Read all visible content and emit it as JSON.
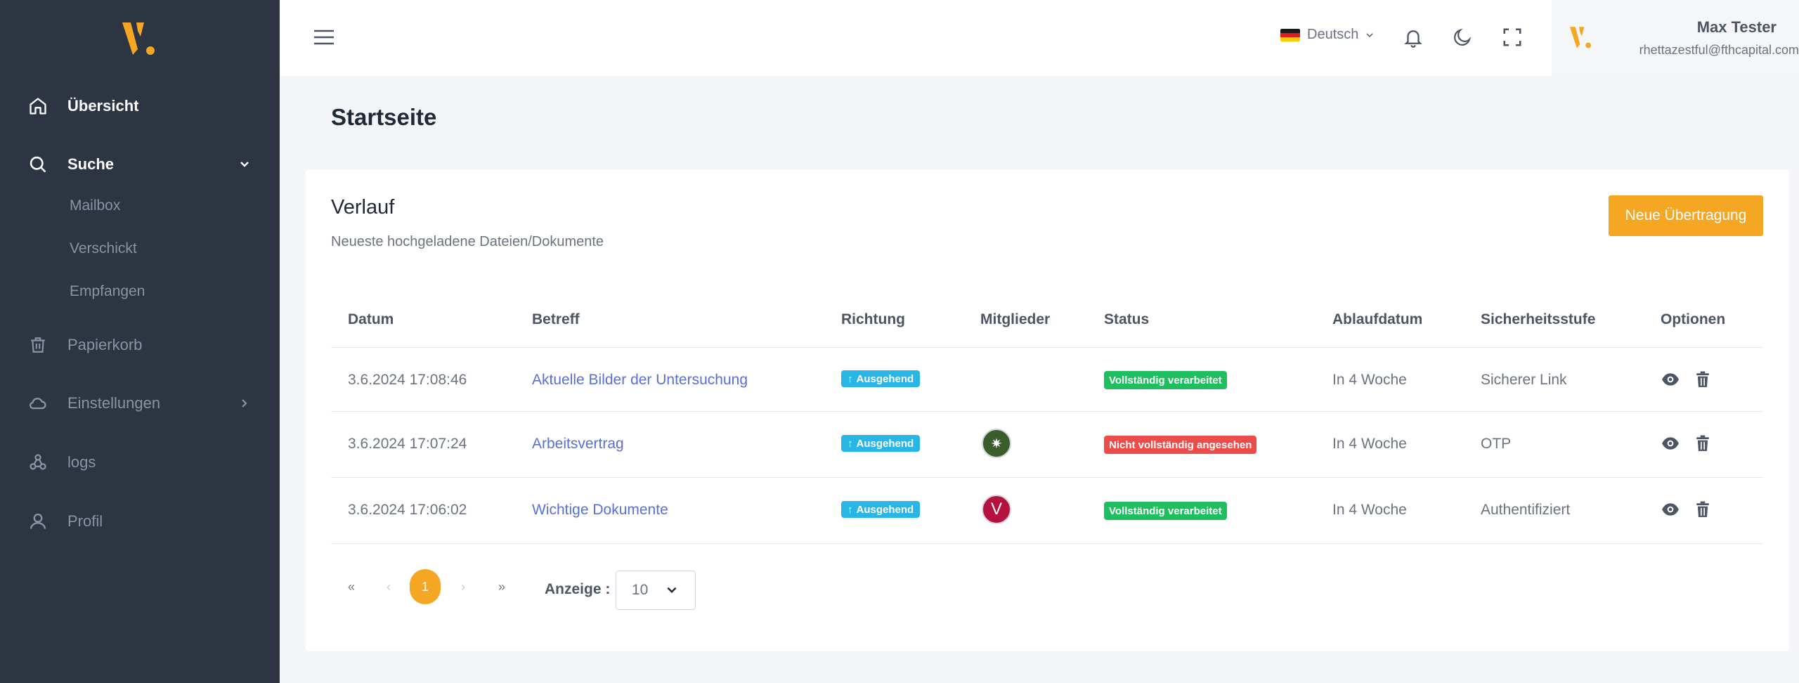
{
  "sidebar": {
    "items": [
      {
        "label": "Übersicht",
        "icon": "home-icon"
      },
      {
        "label": "Suche",
        "icon": "search-icon"
      },
      {
        "label": "Papierkorb",
        "icon": "trash-icon"
      },
      {
        "label": "Einstellungen",
        "icon": "cloud-icon"
      },
      {
        "label": "logs",
        "icon": "webhook-icon"
      },
      {
        "label": "Profil",
        "icon": "user-icon"
      }
    ],
    "search_sub": [
      "Mailbox",
      "Verschickt",
      "Empfangen"
    ]
  },
  "topbar": {
    "language": "Deutsch",
    "user_name": "Max Tester",
    "user_email": "rhettazestful@fthcapital.com"
  },
  "page": {
    "title": "Startseite"
  },
  "card": {
    "title": "Verlauf",
    "subtitle": "Neueste hochgeladene Dateien/Dokumente",
    "new_button": "Neue Übertragung"
  },
  "table": {
    "headers": [
      "Datum",
      "Betreff",
      "Richtung",
      "Mitglieder",
      "Status",
      "Ablaufdatum",
      "Sicherheitsstufe",
      "Optionen"
    ],
    "rows": [
      {
        "date": "3.6.2024 17:08:46",
        "subject": "Aktuelle Bilder der Untersuchung",
        "direction": "Ausgehend",
        "member": "",
        "status": "Vollständig verarbeitet",
        "expiry": "In 4 Woche",
        "security": "Sicherer Link"
      },
      {
        "date": "3.6.2024 17:07:24",
        "subject": "Arbeitsvertrag",
        "direction": "Ausgehend",
        "member": "✷",
        "status": "Nicht vollständig angesehen",
        "expiry": "In 4 Woche",
        "security": "OTP"
      },
      {
        "date": "3.6.2024 17:06:02",
        "subject": "Wichtige Dokumente",
        "direction": "Ausgehend",
        "member": "V",
        "status": "Vollständig verarbeitet",
        "expiry": "In 4 Woche",
        "security": "Authentifiziert"
      }
    ]
  },
  "pagination": {
    "first": "«",
    "prev": "‹",
    "current": "1",
    "next": "›",
    "last": "»",
    "show_label": "Anzeige :",
    "page_size": "10"
  },
  "colors": {
    "sidebar_bg": "#2d3542",
    "accent": "#f5a623",
    "direction_badge": "#29b6e6",
    "status_ok": "#1fbf5f",
    "status_warn": "#ee4b4b",
    "link": "#5a6fd6",
    "avatar_green": "#3b5d2b",
    "avatar_red": "#b5123f"
  }
}
